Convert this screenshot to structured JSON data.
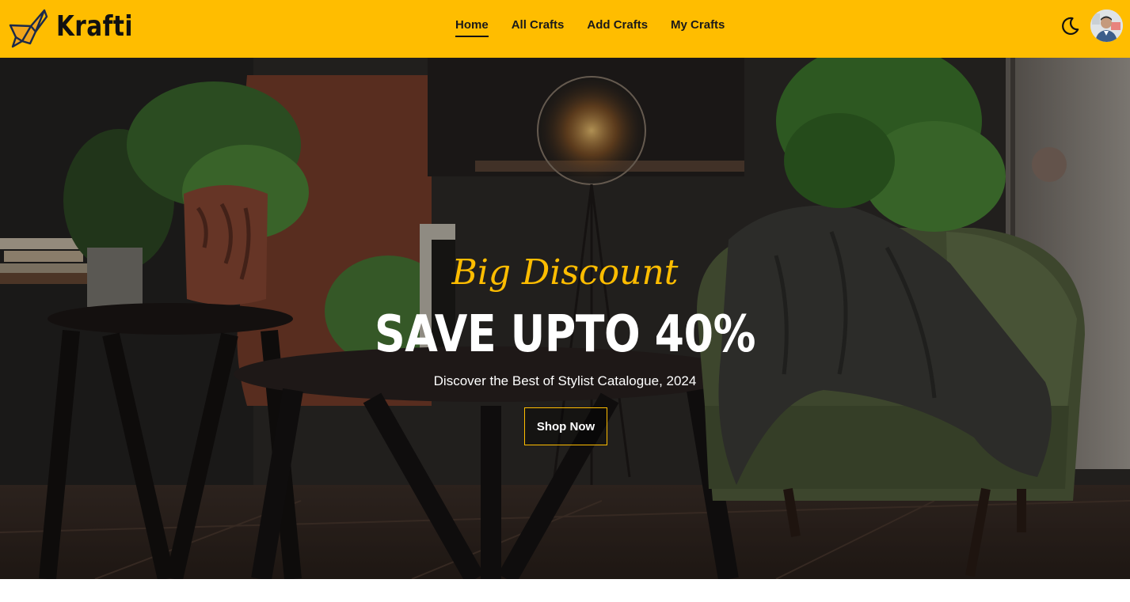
{
  "brand": {
    "name": "Krafti",
    "logo_icon": "origami-bird-icon",
    "accent_color": "#FFBD00"
  },
  "nav": {
    "links": [
      {
        "label": "Home",
        "active": true
      },
      {
        "label": "All Crafts",
        "active": false
      },
      {
        "label": "Add Crafts",
        "active": false
      },
      {
        "label": "My Crafts",
        "active": false
      }
    ],
    "theme_toggle_icon": "moon-icon",
    "avatar_icon": "user-avatar"
  },
  "hero": {
    "tagline": "Big Discount",
    "headline": "SAVE UPTO 40%",
    "subline": "Discover the Best of Stylist Catalogue, 2024",
    "cta_label": "Shop Now"
  }
}
